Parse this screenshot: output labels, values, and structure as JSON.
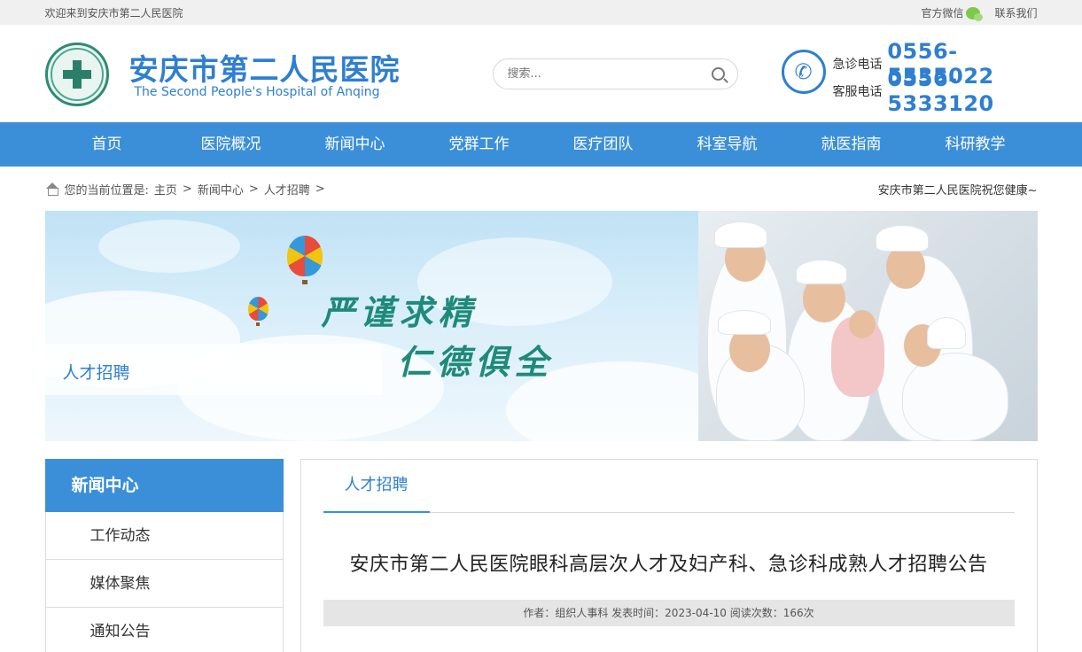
{
  "topbar": {
    "welcome": "欢迎来到安庆市第二人民医院",
    "wechat": "官方微信",
    "contact": "联系我们"
  },
  "header": {
    "title": "安庆市第二人民医院",
    "subtitle": "The Second People's Hospital of Anqing",
    "search_placeholder": "搜索...",
    "phones": [
      {
        "label": "急诊电话",
        "number": "0556-5535022"
      },
      {
        "label": "客服电话",
        "number": "0556-5333120"
      }
    ]
  },
  "nav": [
    "首页",
    "医院概况",
    "新闻中心",
    "党群工作",
    "医疗团队",
    "科室导航",
    "就医指南",
    "科研教学"
  ],
  "breadcrumb": {
    "prefix": "您的当前位置是:",
    "items": [
      "主页",
      "新闻中心",
      "人才招聘"
    ],
    "separator": ">",
    "greeting": "安庆市第二人民医院祝您健康~"
  },
  "banner": {
    "label": "人才招聘",
    "slogan_line1": "严谨求精",
    "slogan_line2": "仁德俱全"
  },
  "sidebar": {
    "heading": "新闻中心",
    "items": [
      "工作动态",
      "媒体聚焦",
      "通知公告"
    ]
  },
  "main": {
    "tab": "人才招聘",
    "article_title": "安庆市第二人民医院眼科高层次人才及妇产科、急诊科成熟人才招聘公告",
    "meta": "作者：组织人事科 发表时间：2023-04-10 阅读次数：166次"
  },
  "colors": {
    "brand_blue": "#3b8fd8",
    "title_blue": "#2f7fd0",
    "slogan_green": "#1e8a7a"
  }
}
